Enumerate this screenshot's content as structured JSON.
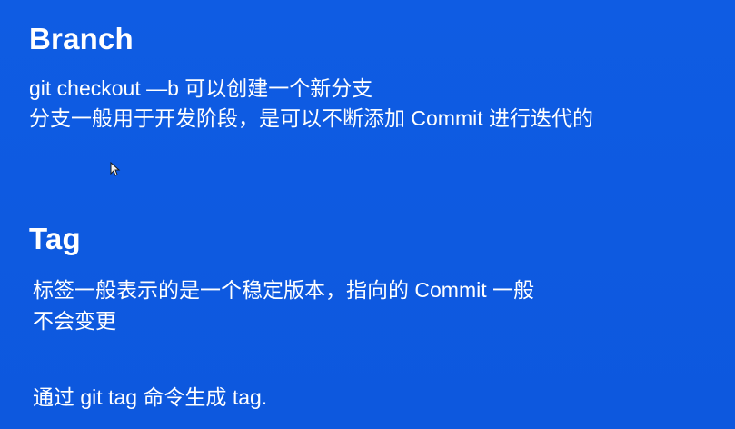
{
  "slide": {
    "branch": {
      "title": "Branch",
      "lines": [
        "git checkout —b 可以创建一个新分支",
        "分支一般用于开发阶段，是可以不断添加 Commit 进行迭代的"
      ]
    },
    "tag": {
      "title": "Tag",
      "lines": [
        "标签一般表示的是一个稳定版本，指向的 Commit 一般",
        "不会变更",
        "通过 git tag 命令生成 tag."
      ]
    }
  },
  "colors": {
    "background": "#0f5ae0",
    "text": "#ffffff"
  },
  "icons": {
    "pointer": "mouse-pointer-icon"
  }
}
